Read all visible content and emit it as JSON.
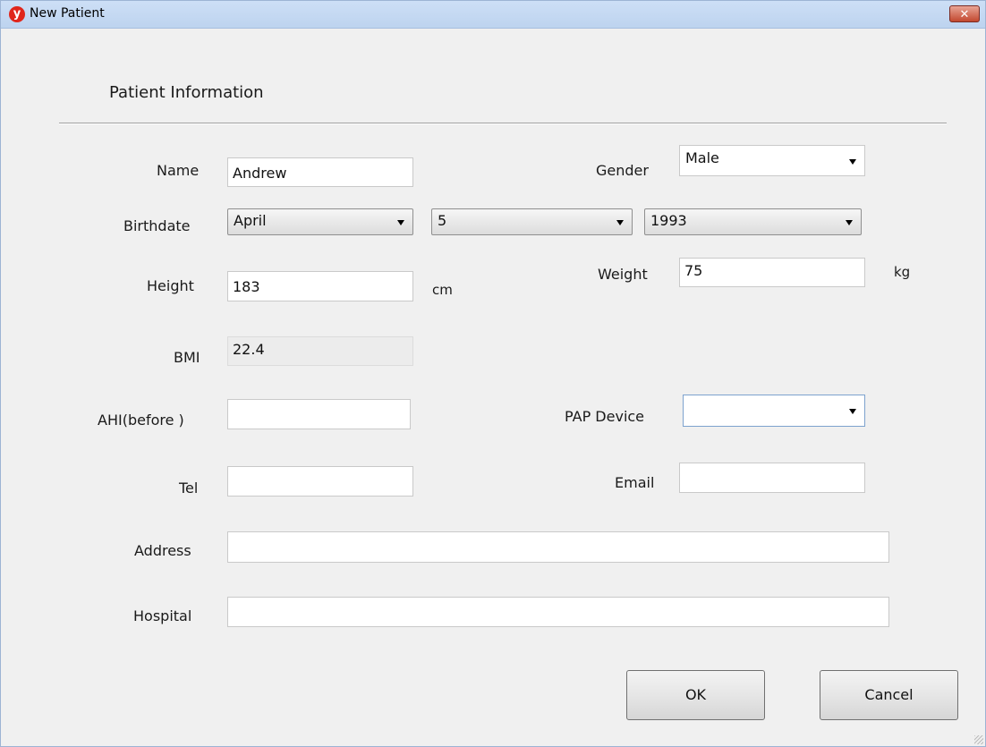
{
  "window": {
    "title": "New Patient",
    "icon": "app-logo-icon",
    "close_glyph": "✕"
  },
  "section_title": "Patient Information",
  "fields": {
    "name": {
      "label": "Name",
      "value": "Andrew"
    },
    "gender": {
      "label": "Gender",
      "value": "Male"
    },
    "birthdate": {
      "label": "Birthdate",
      "month": "April",
      "day": "5",
      "year": "1993"
    },
    "height": {
      "label": "Height",
      "value": "183",
      "unit": "cm"
    },
    "weight": {
      "label": "Weight",
      "value": "75",
      "unit": "kg"
    },
    "bmi": {
      "label": "BMI",
      "value": "22.4"
    },
    "ahi": {
      "label": "AHI(before )",
      "value": ""
    },
    "pap_device": {
      "label": "PAP Device",
      "value": ""
    },
    "tel": {
      "label": "Tel",
      "value": ""
    },
    "email": {
      "label": "Email",
      "value": ""
    },
    "address": {
      "label": "Address",
      "value": ""
    },
    "hospital": {
      "label": "Hospital",
      "value": ""
    }
  },
  "buttons": {
    "ok": "OK",
    "cancel": "Cancel"
  }
}
